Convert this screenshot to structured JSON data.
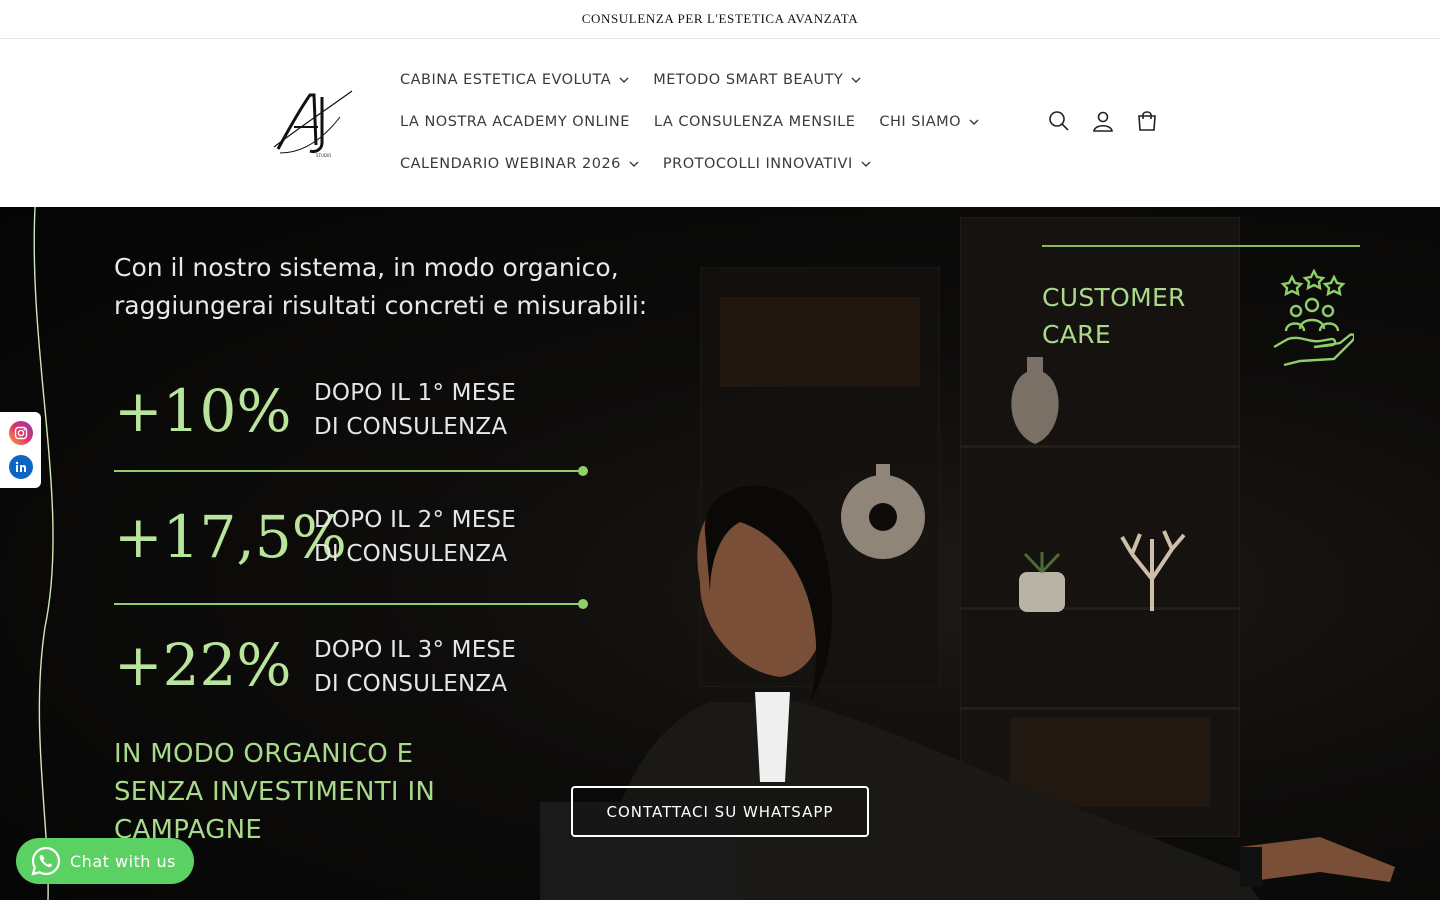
{
  "announcement": {
    "text": "CONSULENZA PER L'ESTETICA AVANZATA"
  },
  "header": {
    "logo_alt": "AI",
    "nav": [
      [
        {
          "label": "CABINA ESTETICA EVOLUTA",
          "has_dropdown": true
        },
        {
          "label": "METODO SMART BEAUTY",
          "has_dropdown": true
        }
      ],
      [
        {
          "label": "LA NOSTRA ACADEMY ONLINE",
          "has_dropdown": false
        },
        {
          "label": "LA CONSULENZA MENSILE",
          "has_dropdown": false
        },
        {
          "label": "CHI SIAMO",
          "has_dropdown": true
        }
      ],
      [
        {
          "label": "CALENDARIO WEBINAR 2026",
          "has_dropdown": true
        },
        {
          "label": "PROTOCOLLI INNOVATIVI",
          "has_dropdown": true
        }
      ]
    ],
    "icons": [
      "search-icon",
      "account-icon",
      "cart-icon"
    ]
  },
  "hero": {
    "intro_line1": "Con il nostro sistema, in modo organico,",
    "intro_line2": "raggiungerai risultati concreti e misurabili:",
    "stats": [
      {
        "value": "+10%",
        "label_line1": "DOPO IL 1° MESE",
        "label_line2": "DI CONSULENZA"
      },
      {
        "value": "+17,5%",
        "label_line1": "DOPO IL 2° MESE",
        "label_line2": "DI CONSULENZA"
      },
      {
        "value": "+22%",
        "label_line1": "DOPO IL 3° MESE",
        "label_line2": "DI CONSULENZA"
      }
    ],
    "organic_line1": "IN MODO ORGANICO E",
    "organic_line2": "SENZA INVESTIMENTI IN",
    "organic_line3": "CAMPAGNE",
    "customer_care_line1": "CUSTOMER",
    "customer_care_line2": "CARE",
    "cta_label": "CONTATTACI SU WHATSAPP",
    "accent_color": "#a9d98b"
  },
  "social": [
    "instagram-icon",
    "linkedin-icon"
  ],
  "chat": {
    "label": "Chat with us",
    "color": "#5bd163"
  }
}
